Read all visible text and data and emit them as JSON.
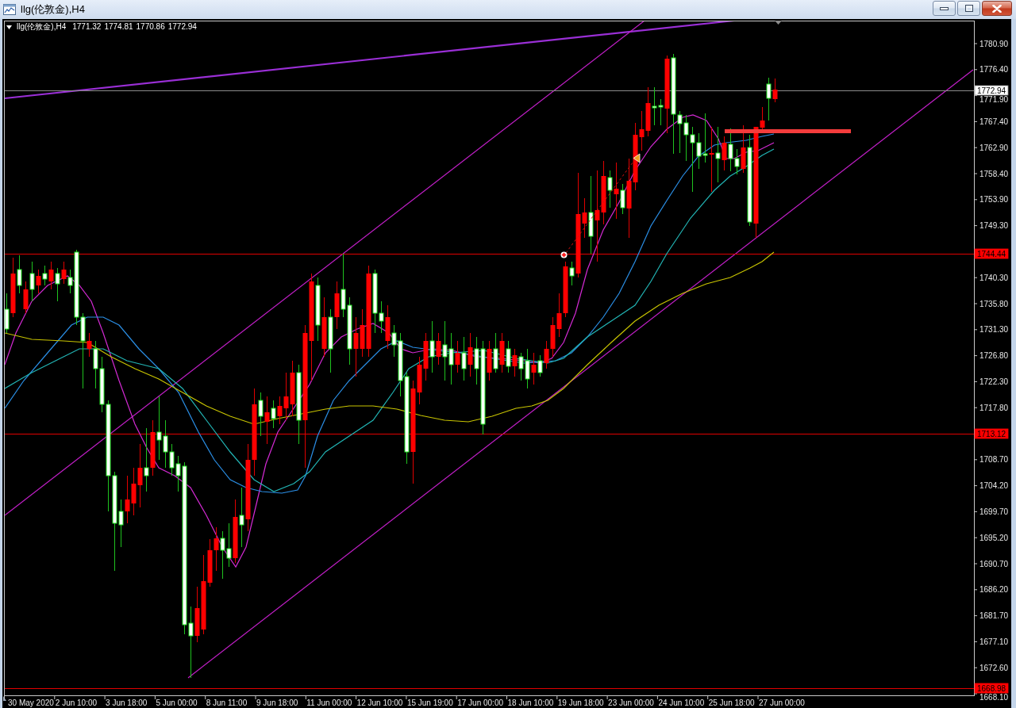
{
  "window": {
    "title": "llg(伦敦金),H4"
  },
  "chart": {
    "symbol": "llg(伦敦金),H4",
    "ohlc": [
      "1771.32",
      "1774.81",
      "1770.86",
      "1772.94"
    ],
    "price_labels": [
      "1780.90",
      "1776.40",
      "1771.90",
      "1767.40",
      "1762.90",
      "1758.40",
      "1753.90",
      "1749.30",
      "1740.30",
      "1735.80",
      "1731.30",
      "1726.80",
      "1722.30",
      "1717.80",
      "1708.70",
      "1704.20",
      "1699.70",
      "1695.20",
      "1690.70",
      "1686.20",
      "1681.70",
      "1677.10",
      "1672.60",
      "1668.10"
    ],
    "price_markers": [
      {
        "kind": "current",
        "value": "1772.94"
      },
      {
        "kind": "level",
        "value": "1744.44"
      },
      {
        "kind": "level",
        "value": "1713.12"
      },
      {
        "kind": "level",
        "value": "1668.98"
      }
    ],
    "time_labels": [
      "30 May 2020",
      "2 Jun 10:00",
      "3 Jun 18:00",
      "5 Jun 00:00",
      "8 Jun 11:00",
      "9 Jun 18:00",
      "11 Jun 00:00",
      "12 Jun 10:00",
      "15 Jun 19:00",
      "17 Jun 00:00",
      "18 Jun 10:00",
      "19 Jun 18:00",
      "23 Jun 00:00",
      "24 Jun 10:00",
      "25 Jun 18:00",
      "27 Jun 00:00"
    ]
  }
}
